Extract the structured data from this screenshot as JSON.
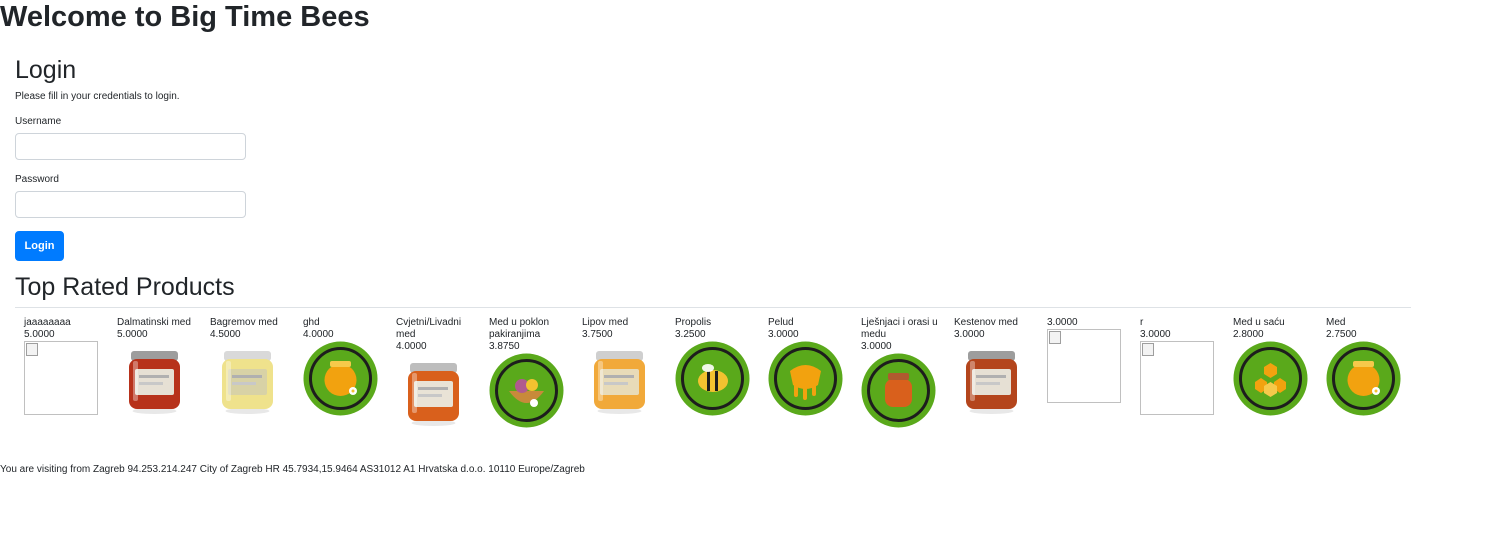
{
  "site": {
    "title": "Welcome to Big Time Bees"
  },
  "login": {
    "title": "Login",
    "hint": "Please fill in your credentials to login.",
    "username_label": "Username",
    "password_label": "Password",
    "username_value": "",
    "password_value": "",
    "button_label": "Login"
  },
  "products": {
    "title": "Top Rated Products",
    "items": [
      {
        "name": "jaaaaaaaa",
        "rating": "5.0000",
        "image": "broken-image"
      },
      {
        "name": "Dalmatinski med",
        "rating": "5.0000",
        "image": "honey-jar-red"
      },
      {
        "name": "Bagremov med",
        "rating": "4.5000",
        "image": "honey-jar-pale"
      },
      {
        "name": "ghd",
        "rating": "4.0000",
        "image": "honey-pot-green-circle"
      },
      {
        "name": "Cvjetni/Livadni med",
        "rating": "4.0000",
        "image": "honey-jar-amber"
      },
      {
        "name": "Med u poklon pakiranjima",
        "rating": "3.8750",
        "image": "gift-basket-green-circle"
      },
      {
        "name": "Lipov med",
        "rating": "3.7500",
        "image": "honey-jar-light"
      },
      {
        "name": "Propolis",
        "rating": "3.2500",
        "image": "bee-green-circle"
      },
      {
        "name": "Pelud",
        "rating": "3.0000",
        "image": "pollen-green-circle"
      },
      {
        "name": "Lješnjaci i orasi u medu",
        "rating": "3.0000",
        "image": "nut-jar-green-circle"
      },
      {
        "name": "Kestenov med",
        "rating": "3.0000",
        "image": "honey-jar-dark"
      },
      {
        "name": "",
        "rating": "3.0000",
        "image": "broken-image"
      },
      {
        "name": "r",
        "rating": "3.0000",
        "image": "broken-image"
      },
      {
        "name": "Med u saću",
        "rating": "2.8000",
        "image": "honeycomb-green-circle"
      },
      {
        "name": "Med",
        "rating": "2.7500",
        "image": "honey-pot-green-circle"
      }
    ]
  },
  "colors": {
    "primary": "#007bff",
    "badge_green": "#5aa91b",
    "honey": "#f2a20f"
  },
  "visitor": {
    "info": "You are visiting from Zagreb 94.253.214.247 City of Zagreb HR 45.7934,15.9464 AS31012 A1 Hrvatska d.o.o. 10110 Europe/Zagreb"
  }
}
